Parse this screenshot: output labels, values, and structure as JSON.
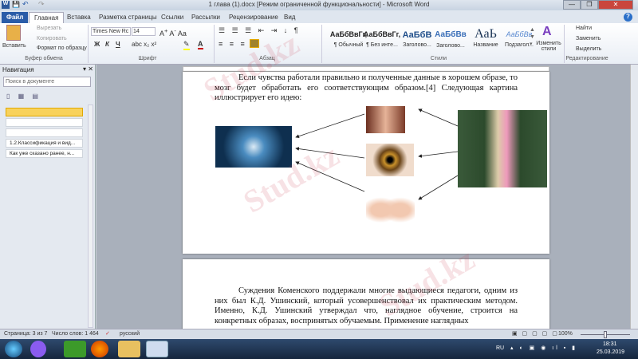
{
  "window": {
    "title": "1 глава (1).docx [Режим ограниченной функциональности] - Microsoft Word",
    "minimize": "—",
    "restore": "❐",
    "close": "✕"
  },
  "tabs": [
    "Файл",
    "Главная",
    "Вставка",
    "Разметка страницы",
    "Ссылки",
    "Рассылки",
    "Рецензирование",
    "Вид"
  ],
  "ribbon": {
    "clipboard": {
      "paste": "Вставить",
      "cut": "Вырезать",
      "copy": "Копировать",
      "format_painter": "Формат по образцу",
      "label": "Буфер обмена"
    },
    "font": {
      "name": "Times New Rc",
      "size": "14",
      "bold": "Ж",
      "italic": "К",
      "underline": "Ч",
      "label": "Шрифт"
    },
    "paragraph": {
      "label": "Абзац"
    },
    "styles": {
      "items": [
        {
          "sample": "АаБбВвГг,",
          "name": "¶ Обычный"
        },
        {
          "sample": "АаБбВвГг,",
          "name": "¶ Без инте..."
        },
        {
          "sample": "АаБбВ",
          "name": "Заголово..."
        },
        {
          "sample": "АаБбВв",
          "name": "Заголово..."
        },
        {
          "sample": "АаЬ",
          "name": "Название"
        },
        {
          "sample": "АаБбВв",
          "name": "Подзагол..."
        }
      ],
      "change": "Изменить стили",
      "label": "Стили"
    },
    "editing": {
      "find": "Найти",
      "replace": "Заменить",
      "select": "Выделить",
      "label": "Редактирование"
    }
  },
  "nav": {
    "title": "Навигация",
    "search_placeholder": "Поиск в документе",
    "items": [
      "",
      "",
      "",
      "1.2.Классификация и вид...",
      "Как уже сказано ранее, н..."
    ]
  },
  "document": {
    "page1_text": "Если чувства работали правильно и полученные данные в хорошем образе, то мозг будет обработать его соответствующим образом.[4] Следующая картина иллюстрирует его идею:",
    "page2_text": "Суждения Коменского поддержали многие выдающиеся педагоги, одним из них был К.Д. Ушинский, который усовершенствовал их практическим методом. Именно, К.Д. Ушинский утверждал что, наглядное обучение, строится на конкретных образах, воспринятых обучаемым. Применение наглядных"
  },
  "status": {
    "page": "Страница: 3 из 7",
    "words": "Число слов: 1 464",
    "language": "русский",
    "zoom": "100%"
  },
  "taskbar": {
    "lang": "RU",
    "time": "18:31",
    "date": "25.03.2019"
  },
  "watermark": "Stud.kz"
}
